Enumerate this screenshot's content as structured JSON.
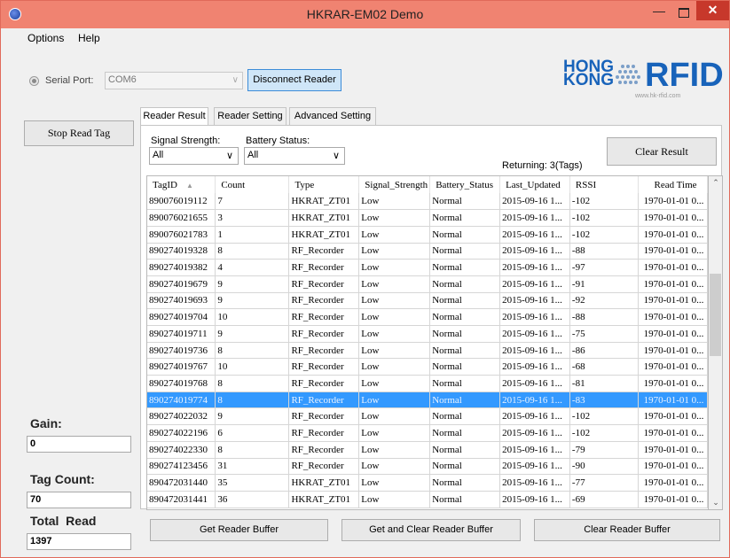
{
  "window": {
    "title": "HKRAR-EM02 Demo"
  },
  "menu": {
    "options": "Options",
    "help": "Help"
  },
  "connection": {
    "serial_port_label": "Serial Port:",
    "port_value": "COM6",
    "disconnect_label": "Disconnect Reader"
  },
  "logo": {
    "hong": "HONG",
    "kong": "KONG",
    "rfid": "RFID",
    "url": "www.hk-rfid.com"
  },
  "stop_read_label": "Stop Read Tag",
  "tabs": [
    {
      "label": "Reader Result",
      "active": true
    },
    {
      "label": "Reader Setting",
      "active": false
    },
    {
      "label": "Advanced Setting",
      "active": false
    }
  ],
  "filters": {
    "signal_label": "Signal Strength:",
    "signal_value": "All",
    "battery_label": "Battery Status:",
    "battery_value": "All"
  },
  "returning_text": "Returning: 3(Tags)",
  "clear_result_label": "Clear Result",
  "table": {
    "columns": [
      "TagID",
      "Count",
      "Type",
      "Signal_Strength",
      "Battery_Status",
      "Last_Updated",
      "RSSI",
      "Read Time"
    ],
    "rows": [
      [
        "890076019112",
        "7",
        "HKRAT_ZT01",
        "Low",
        "Normal",
        "2015-09-16 1...",
        "-102",
        "1970-01-01 0..."
      ],
      [
        "890076021655",
        "3",
        "HKRAT_ZT01",
        "Low",
        "Normal",
        "2015-09-16 1...",
        "-102",
        "1970-01-01 0..."
      ],
      [
        "890076021783",
        "1",
        "HKRAT_ZT01",
        "Low",
        "Normal",
        "2015-09-16 1...",
        "-102",
        "1970-01-01 0..."
      ],
      [
        "890274019328",
        "8",
        "RF_Recorder",
        "Low",
        "Normal",
        "2015-09-16 1...",
        "-88",
        "1970-01-01 0..."
      ],
      [
        "890274019382",
        "4",
        "RF_Recorder",
        "Low",
        "Normal",
        "2015-09-16 1...",
        "-97",
        "1970-01-01 0..."
      ],
      [
        "890274019679",
        "9",
        "RF_Recorder",
        "Low",
        "Normal",
        "2015-09-16 1...",
        "-91",
        "1970-01-01 0..."
      ],
      [
        "890274019693",
        "9",
        "RF_Recorder",
        "Low",
        "Normal",
        "2015-09-16 1...",
        "-92",
        "1970-01-01 0..."
      ],
      [
        "890274019704",
        "10",
        "RF_Recorder",
        "Low",
        "Normal",
        "2015-09-16 1...",
        "-88",
        "1970-01-01 0..."
      ],
      [
        "890274019711",
        "9",
        "RF_Recorder",
        "Low",
        "Normal",
        "2015-09-16 1...",
        "-75",
        "1970-01-01 0..."
      ],
      [
        "890274019736",
        "8",
        "RF_Recorder",
        "Low",
        "Normal",
        "2015-09-16 1...",
        "-86",
        "1970-01-01 0..."
      ],
      [
        "890274019767",
        "10",
        "RF_Recorder",
        "Low",
        "Normal",
        "2015-09-16 1...",
        "-68",
        "1970-01-01 0..."
      ],
      [
        "890274019768",
        "8",
        "RF_Recorder",
        "Low",
        "Normal",
        "2015-09-16 1...",
        "-81",
        "1970-01-01 0..."
      ],
      [
        "890274019774",
        "8",
        "RF_Recorder",
        "Low",
        "Normal",
        "2015-09-16 1...",
        "-83",
        "1970-01-01 0..."
      ],
      [
        "890274022032",
        "9",
        "RF_Recorder",
        "Low",
        "Normal",
        "2015-09-16 1...",
        "-102",
        "1970-01-01 0..."
      ],
      [
        "890274022196",
        "6",
        "RF_Recorder",
        "Low",
        "Normal",
        "2015-09-16 1...",
        "-102",
        "1970-01-01 0..."
      ],
      [
        "890274022330",
        "8",
        "RF_Recorder",
        "Low",
        "Normal",
        "2015-09-16 1...",
        "-79",
        "1970-01-01 0..."
      ],
      [
        "890274123456",
        "31",
        "RF_Recorder",
        "Low",
        "Normal",
        "2015-09-16 1...",
        "-90",
        "1970-01-01 0..."
      ],
      [
        "890472031440",
        "35",
        "HKRAT_ZT01",
        "Low",
        "Normal",
        "2015-09-16 1...",
        "-77",
        "1970-01-01 0..."
      ],
      [
        "890472031441",
        "36",
        "HKRAT_ZT01",
        "Low",
        "Normal",
        "2015-09-16 1...",
        "-69",
        "1970-01-01 0..."
      ]
    ],
    "selected_row": 12,
    "selected_color": "#3399ff"
  },
  "sidebar": {
    "gain_label": "Gain:",
    "gain_value": "0",
    "tag_count_label": "Tag Count:",
    "tag_count_value": "70",
    "total_read_label": "Total  Read",
    "total_read_value": "1397"
  },
  "buffer_buttons": {
    "get": "Get Reader Buffer",
    "get_and_clear": "Get and Clear Reader Buffer",
    "clear": "Clear Reader Buffer"
  },
  "colors": {
    "titlebar": "#f08371",
    "close_button": "#c7382b",
    "accent_blue": "#1863ba",
    "button_highlight": "#cfe6f8"
  }
}
